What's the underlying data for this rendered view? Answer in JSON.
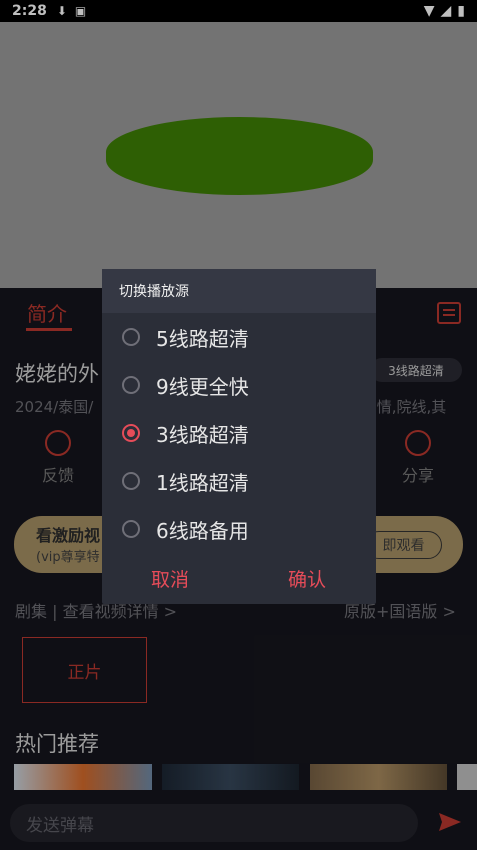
{
  "status_bar": {
    "time": "2:28",
    "icons": [
      "download-icon",
      "a-icon",
      "wifi-icon",
      "signal-icon",
      "battery-icon"
    ]
  },
  "tabs": {
    "intro": "简介"
  },
  "video": {
    "title": "姥姥的外",
    "line_chip": "3线路超清",
    "meta_left": "2024/泰国/",
    "meta_right": ".情,院线,其"
  },
  "actions": {
    "feedback": "反馈",
    "share": "分享"
  },
  "promo": {
    "title": "看激励视",
    "subtitle": "(vip尊享特",
    "button": "即观看"
  },
  "episodes": {
    "header_left": "剧集 | 查看视频详情 >",
    "header_right": "原版+国语版 >",
    "item": "正片"
  },
  "recommend": {
    "title": "热门推荐"
  },
  "danmu": {
    "placeholder": "发送弹幕"
  },
  "dialog": {
    "title": "切换播放源",
    "options": [
      {
        "label": "5线路超清",
        "selected": false
      },
      {
        "label": "9线更全快",
        "selected": false
      },
      {
        "label": "3线路超清",
        "selected": true
      },
      {
        "label": "1线路超清",
        "selected": false
      },
      {
        "label": "6线路备用",
        "selected": false
      }
    ],
    "cancel": "取消",
    "confirm": "确认"
  },
  "colors": {
    "accent": "#e64c59",
    "player_bg": "#9a9a9a",
    "player_shape": "#3e7f06"
  }
}
